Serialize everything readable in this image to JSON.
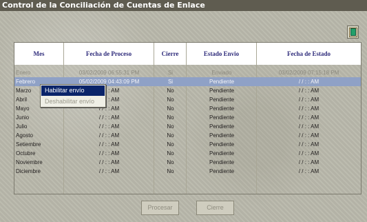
{
  "window": {
    "title": "Control de la Conciliación de Cuentas de Enlace"
  },
  "icons": {
    "exit": "exit-door-icon"
  },
  "table": {
    "columns": [
      "Mes",
      "Fecha de Proceso",
      "Cierre",
      "Estado Envio",
      "Fecha de Estado"
    ],
    "rows": [
      {
        "mes": "Enero",
        "fecha_proceso": "03/02/2009 06:55:31 PM",
        "cierre": "Si",
        "estado": "Enviado",
        "fecha_estado": "03/02/2009 07:15:18 PM"
      },
      {
        "mes": "Febrero",
        "fecha_proceso": "05/02/2009 04:43:09 PM",
        "cierre": "Si",
        "estado": "Pendiente",
        "fecha_estado": " /  /      :  :   AM"
      },
      {
        "mes": "Marzo",
        "fecha_proceso": " /  /      :  :   AM",
        "cierre": "No",
        "estado": "Pendiente",
        "fecha_estado": " /  /      :  :   AM"
      },
      {
        "mes": "Abril",
        "fecha_proceso": " /  /      :  :   AM",
        "cierre": "No",
        "estado": "Pendiente",
        "fecha_estado": " /  /      :  :   AM"
      },
      {
        "mes": "Mayo",
        "fecha_proceso": " /  /      :  :   AM",
        "cierre": "No",
        "estado": "Pendiente",
        "fecha_estado": " /  /      :  :   AM"
      },
      {
        "mes": "Junio",
        "fecha_proceso": " /  /      :  :   AM",
        "cierre": "No",
        "estado": "Pendiente",
        "fecha_estado": " /  /      :  :   AM"
      },
      {
        "mes": "Julio",
        "fecha_proceso": " /  /      :  :   AM",
        "cierre": "No",
        "estado": "Pendiente",
        "fecha_estado": " /  /      :  :   AM"
      },
      {
        "mes": "Agosto",
        "fecha_proceso": " /  /      :  :   AM",
        "cierre": "No",
        "estado": "Pendiente",
        "fecha_estado": " /  /      :  :   AM"
      },
      {
        "mes": "Setiembre",
        "fecha_proceso": " /  /      :  :   AM",
        "cierre": "No",
        "estado": "Pendiente",
        "fecha_estado": " /  /      :  :   AM"
      },
      {
        "mes": "Octubre",
        "fecha_proceso": " /  /      :  :   AM",
        "cierre": "No",
        "estado": "Pendiente",
        "fecha_estado": " /  /      :  :   AM"
      },
      {
        "mes": "Noviembre",
        "fecha_proceso": " /  /      :  :   AM",
        "cierre": "No",
        "estado": "Pendiente",
        "fecha_estado": " /  /      :  :   AM"
      },
      {
        "mes": "Diciembre",
        "fecha_proceso": " /  /      :  :   AM",
        "cierre": "No",
        "estado": "Pendiente",
        "fecha_estado": " /  /      :  :   AM"
      }
    ]
  },
  "context_menu": {
    "items": [
      "Habilitar envío",
      "Deshabilitar envío"
    ]
  },
  "buttons": {
    "procesar": "Procesar",
    "cierre": "Cierre"
  }
}
